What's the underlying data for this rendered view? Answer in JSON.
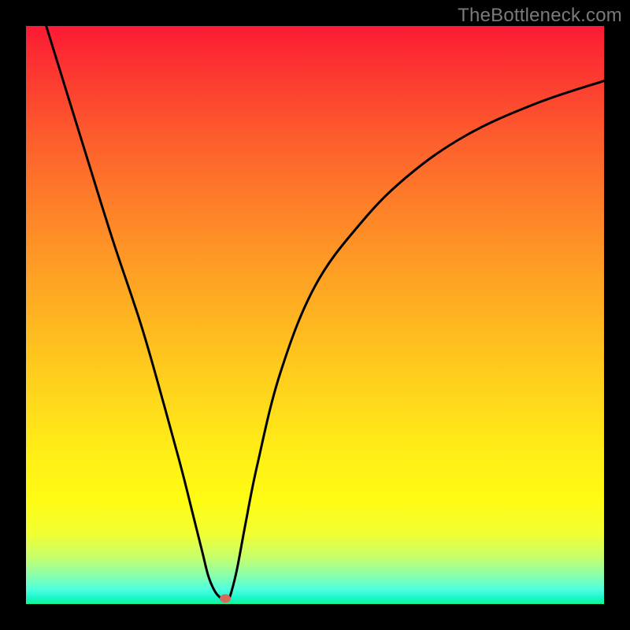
{
  "watermark": "TheBottleneck.com",
  "chart_data": {
    "type": "line",
    "title": "",
    "xlabel": "",
    "ylabel": "",
    "xlim": [
      0,
      100
    ],
    "ylim": [
      0,
      100
    ],
    "grid": false,
    "series": [
      {
        "name": "curve",
        "x": [
          3.5,
          10,
          15,
          20,
          24,
          27,
          29,
          30.5,
          31.5,
          32.5,
          33.5,
          34.5,
          35,
          35.5,
          36.5,
          38,
          40,
          44,
          50,
          58,
          66,
          76,
          88,
          100
        ],
        "values": [
          100,
          79,
          63,
          48,
          34,
          23,
          15,
          9,
          5,
          2.5,
          1.2,
          0.8,
          0.8,
          2,
          6,
          14,
          24,
          40,
          55,
          66,
          74,
          81,
          86.5,
          90.5
        ]
      }
    ],
    "marker": {
      "x": 34.5,
      "y": 1.0,
      "color": "#d66a5f"
    },
    "gradient_stops": [
      {
        "pos": 0.0,
        "color": "#fc1a34"
      },
      {
        "pos": 0.2,
        "color": "#fd5f2d"
      },
      {
        "pos": 0.44,
        "color": "#fea324"
      },
      {
        "pos": 0.65,
        "color": "#ffd91b"
      },
      {
        "pos": 0.82,
        "color": "#fffb13"
      },
      {
        "pos": 0.95,
        "color": "#8bffab"
      },
      {
        "pos": 1.0,
        "color": "#14f58f"
      }
    ]
  }
}
